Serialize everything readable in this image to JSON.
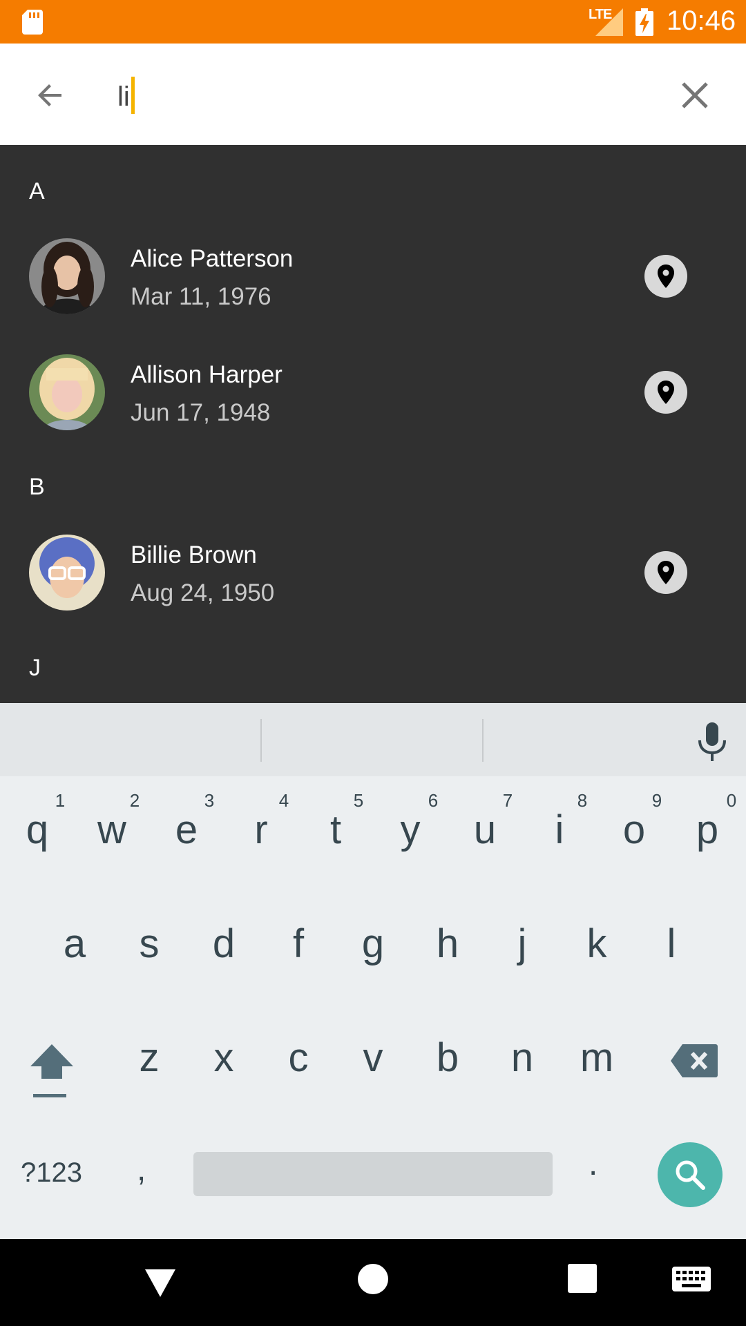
{
  "status_bar": {
    "network": "LTE",
    "time": "10:46",
    "icons": [
      "sd-card-icon",
      "signal-icon",
      "battery-charging-icon"
    ],
    "background_color": "#F57C00"
  },
  "search": {
    "query": "li",
    "caret_color": "#F5B400",
    "icons": [
      "arrow-back-icon",
      "close-icon"
    ]
  },
  "contacts": {
    "sections": [
      {
        "letter": "A",
        "items": [
          {
            "name": "Alice Patterson",
            "date": "Mar 11, 1976",
            "action_icon": "location-pin-icon"
          },
          {
            "name": "Allison Harper",
            "date": "Jun 17, 1948",
            "action_icon": "location-pin-icon"
          }
        ]
      },
      {
        "letter": "B",
        "items": [
          {
            "name": "Billie Brown",
            "date": "Aug 24, 1950",
            "action_icon": "location-pin-icon"
          }
        ]
      },
      {
        "letter": "J",
        "items": []
      }
    ]
  },
  "keyboard": {
    "row1": [
      "q",
      "w",
      "e",
      "r",
      "t",
      "y",
      "u",
      "i",
      "o",
      "p"
    ],
    "row1_hints": [
      "1",
      "2",
      "3",
      "4",
      "5",
      "6",
      "7",
      "8",
      "9",
      "0"
    ],
    "row2": [
      "a",
      "s",
      "d",
      "f",
      "g",
      "h",
      "j",
      "k",
      "l"
    ],
    "row3": [
      "z",
      "x",
      "c",
      "v",
      "b",
      "n",
      "m"
    ],
    "symbols_key": "?123",
    "comma_key": ",",
    "period_key": ".",
    "action_icon": "search-icon",
    "action_color": "#4DB6AC"
  },
  "nav_bar": {
    "icons": [
      "nav-back-icon",
      "nav-home-icon",
      "nav-recents-icon",
      "keyboard-switch-icon"
    ]
  }
}
